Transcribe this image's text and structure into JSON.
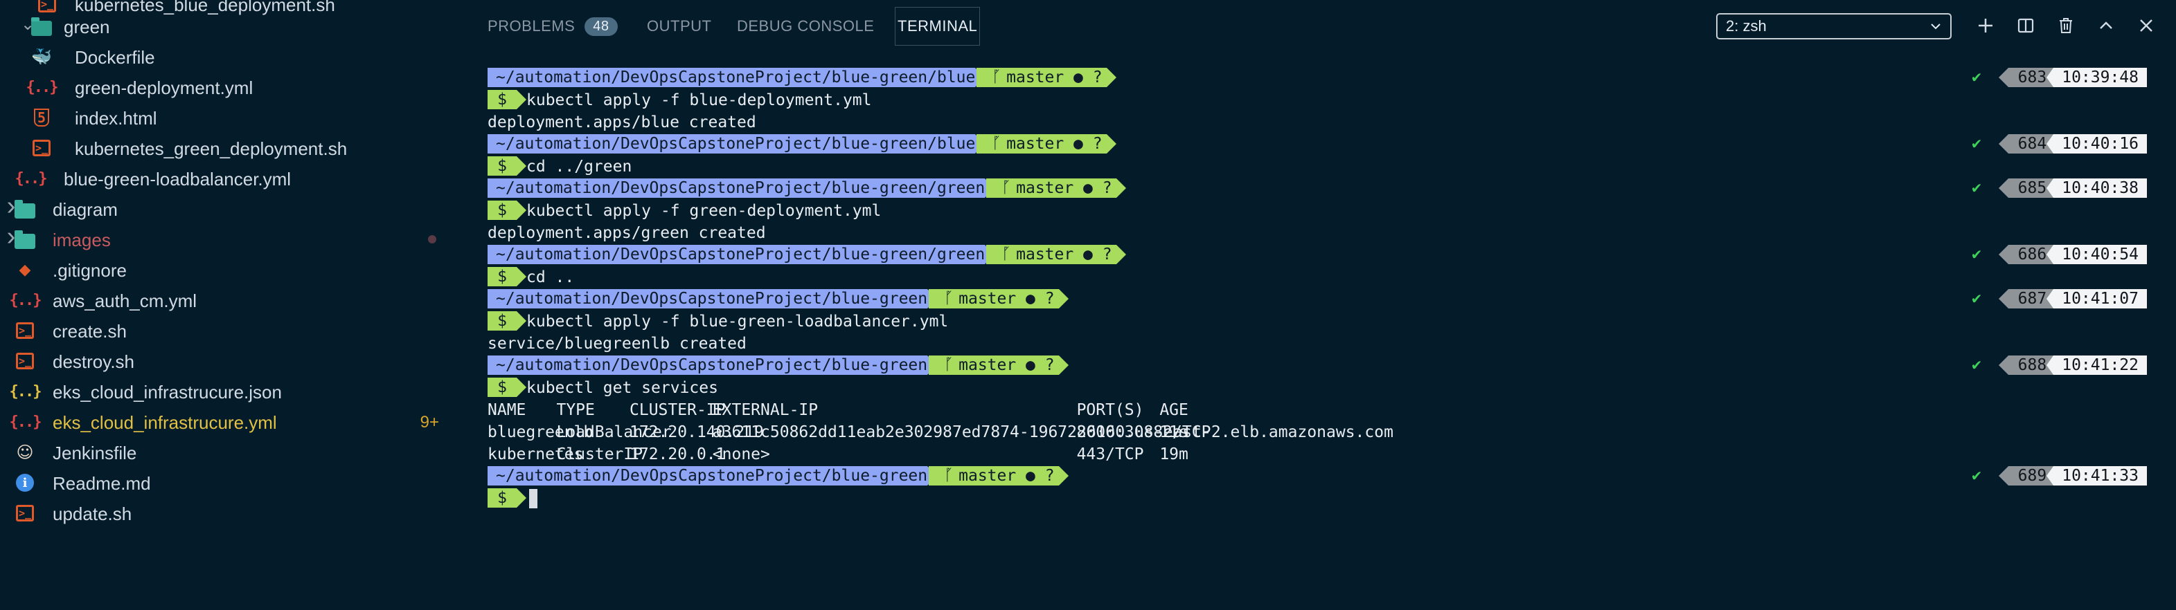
{
  "explorer": {
    "items": [
      {
        "label": "kubernetes_blue_deployment.sh",
        "icon": "shell-script-icon",
        "kind": "sh"
      },
      {
        "label": "green",
        "icon": "folder-open-icon",
        "kind": "folder-open"
      },
      {
        "label": "Dockerfile",
        "icon": "docker-icon",
        "kind": "docker"
      },
      {
        "label": "green-deployment.yml",
        "icon": "yaml-file-icon",
        "kind": "yml"
      },
      {
        "label": "index.html",
        "icon": "html-file-icon",
        "kind": "html"
      },
      {
        "label": "kubernetes_green_deployment.sh",
        "icon": "shell-script-icon",
        "kind": "sh"
      },
      {
        "label": "blue-green-loadbalancer.yml",
        "icon": "yaml-file-icon",
        "kind": "yml"
      },
      {
        "label": "diagram",
        "icon": "folder-icon",
        "kind": "folder"
      },
      {
        "label": "images",
        "icon": "folder-icon",
        "kind": "folder"
      },
      {
        "label": ".gitignore",
        "icon": "git-icon",
        "kind": "git"
      },
      {
        "label": "aws_auth_cm.yml",
        "icon": "yaml-file-icon",
        "kind": "yml"
      },
      {
        "label": "create.sh",
        "icon": "shell-script-icon",
        "kind": "sh"
      },
      {
        "label": "destroy.sh",
        "icon": "shell-script-icon",
        "kind": "sh"
      },
      {
        "label": "eks_cloud_infrastrucure.json",
        "icon": "json-file-icon",
        "kind": "json"
      },
      {
        "label": "eks_cloud_infrastrucure.yml",
        "icon": "yaml-file-icon",
        "kind": "yml",
        "badge": "9+"
      },
      {
        "label": "Jenkinsfile",
        "icon": "jenkins-icon",
        "kind": "jenkins"
      },
      {
        "label": "Readme.md",
        "icon": "info-icon",
        "kind": "info"
      },
      {
        "label": "update.sh",
        "icon": "shell-script-icon",
        "kind": "sh"
      }
    ]
  },
  "panel": {
    "tabs": [
      {
        "label": "PROBLEMS",
        "badge": "48"
      },
      {
        "label": "OUTPUT"
      },
      {
        "label": "DEBUG CONSOLE"
      },
      {
        "label": "TERMINAL",
        "active": true
      }
    ],
    "terminal_select": "2: zsh"
  },
  "terminal": {
    "lines": [
      {
        "type": "prompt",
        "path": "~/automation/DevOpsCapstoneProject/blue-green/blue",
        "git": "master ● ?",
        "num": "683",
        "time": "10:39:48"
      },
      {
        "type": "cmd",
        "text": "kubectl apply -f blue-deployment.yml"
      },
      {
        "type": "out",
        "text": "deployment.apps/blue created"
      },
      {
        "type": "prompt",
        "path": "~/automation/DevOpsCapstoneProject/blue-green/blue",
        "git": "master ● ?",
        "num": "684",
        "time": "10:40:16"
      },
      {
        "type": "cmd",
        "text": "cd ../green"
      },
      {
        "type": "prompt",
        "path": "~/automation/DevOpsCapstoneProject/blue-green/green",
        "git": "master ● ?",
        "num": "685",
        "time": "10:40:38"
      },
      {
        "type": "cmd",
        "text": "kubectl apply -f green-deployment.yml"
      },
      {
        "type": "out",
        "text": "deployment.apps/green created"
      },
      {
        "type": "prompt",
        "path": "~/automation/DevOpsCapstoneProject/blue-green/green",
        "git": "master ● ?",
        "num": "686",
        "time": "10:40:54"
      },
      {
        "type": "cmd",
        "text": "cd .."
      },
      {
        "type": "prompt",
        "path": "~/automation/DevOpsCapstoneProject/blue-green",
        "git": "master ● ?",
        "num": "687",
        "time": "10:41:07"
      },
      {
        "type": "cmd",
        "text": "kubectl apply -f blue-green-loadbalancer.yml"
      },
      {
        "type": "out",
        "text": "service/bluegreenlb created"
      },
      {
        "type": "prompt",
        "path": "~/automation/DevOpsCapstoneProject/blue-green",
        "git": "master ● ?",
        "num": "688",
        "time": "10:41:22"
      },
      {
        "type": "cmd",
        "text": "kubectl get services"
      },
      {
        "type": "row",
        "cells": [
          "NAME",
          "TYPE",
          "CLUSTER-IP",
          "EXTERNAL-IP",
          "PORT(S)",
          "AGE"
        ]
      },
      {
        "type": "row",
        "cells": [
          "bluegreenlb",
          "LoadBalancer",
          "172.20.140.219",
          "a3611c50862dd11eab2e302987ed7874-1967226160.us-east-2.elb.amazonaws.com",
          "8000:30882/TCP",
          "11s"
        ]
      },
      {
        "type": "row",
        "cells": [
          "kubernetes",
          "ClusterIP",
          "172.20.0.1",
          "<none>",
          "443/TCP",
          "19m"
        ]
      },
      {
        "type": "prompt",
        "path": "~/automation/DevOpsCapstoneProject/blue-green",
        "git": "master ● ?",
        "num": "689",
        "time": "10:41:33"
      },
      {
        "type": "input"
      }
    ]
  }
}
